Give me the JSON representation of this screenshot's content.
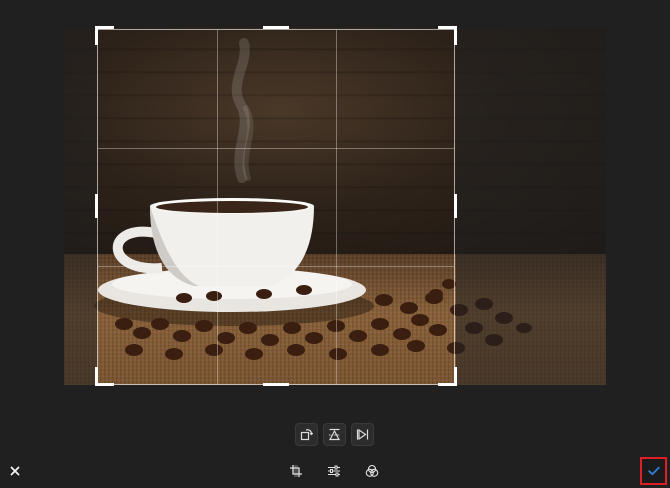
{
  "app": {
    "accent_color": "#2f7fd6",
    "confirm_highlight_color": "#e01e26"
  },
  "canvas": {
    "image_subject": "photo",
    "crop_grid": "rule-of-thirds"
  },
  "sub_tools": [
    {
      "name": "rotate-icon"
    },
    {
      "name": "flip-vertical-icon"
    },
    {
      "name": "flip-horizontal-icon"
    }
  ],
  "main_tools": [
    {
      "name": "crop-icon"
    },
    {
      "name": "adjust-sliders-icon"
    },
    {
      "name": "filters-icon"
    }
  ],
  "actions": {
    "cancel": {
      "name": "close-icon"
    },
    "confirm": {
      "name": "checkmark-icon"
    }
  }
}
